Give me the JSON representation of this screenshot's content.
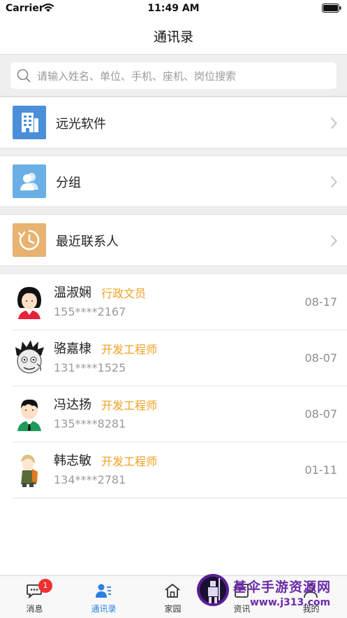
{
  "status_bar": {
    "carrier": "Carrier",
    "time": "11:49 AM"
  },
  "nav": {
    "title": "通讯录"
  },
  "search": {
    "placeholder": "请输入姓名、单位、手机、座机、岗位搜索",
    "icon": "search-icon"
  },
  "menu": [
    {
      "label": "远光软件",
      "icon": "building-icon",
      "color": "#4a8fd8"
    },
    {
      "label": "分组",
      "icon": "group-icon",
      "color": "#6ab0e6"
    },
    {
      "label": "最近联系人",
      "icon": "clock-icon",
      "color": "#e8b270"
    }
  ],
  "contacts": [
    {
      "name": "温淑娴",
      "title": "行政文员",
      "phone": "155****2167",
      "date": "08-17"
    },
    {
      "name": "骆嘉棣",
      "title": "开发工程师",
      "phone": "131****1525",
      "date": "08-07"
    },
    {
      "name": "冯达扬",
      "title": "开发工程师",
      "phone": "135****8281",
      "date": "08-07"
    },
    {
      "name": "韩志敏",
      "title": "开发工程师",
      "phone": "134****2781",
      "date": "01-11"
    }
  ],
  "tabs": [
    {
      "label": "消息",
      "icon": "chat-icon",
      "badge": "1"
    },
    {
      "label": "通讯录",
      "icon": "contacts-icon",
      "active": true
    },
    {
      "label": "家园",
      "icon": "home-icon"
    },
    {
      "label": "资讯",
      "icon": "news-icon"
    },
    {
      "label": "我的",
      "icon": "profile-icon"
    }
  ],
  "watermark": {
    "title": "基伞手游资源网",
    "url": "www.j313.com"
  },
  "colors": {
    "accent": "#2a7fe0",
    "title_orange": "#f0a020",
    "badge_red": "#f03030"
  }
}
